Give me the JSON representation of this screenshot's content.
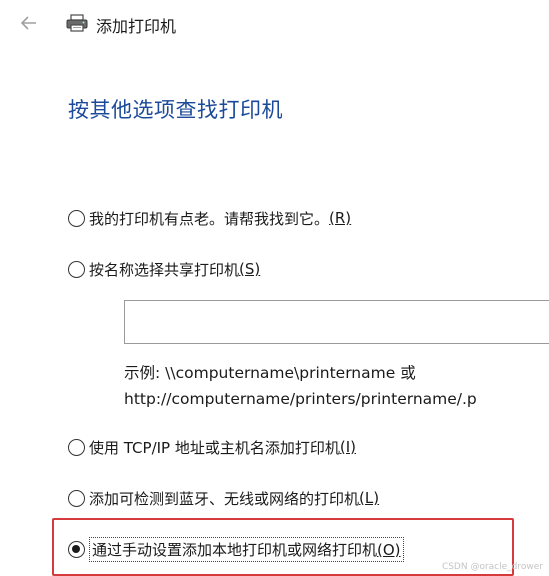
{
  "titlebar": {
    "back_icon": "back-arrow-icon",
    "title_icon": "printer-icon",
    "title": "添加打印机"
  },
  "heading": "按其他选项查找打印机",
  "options": [
    {
      "label": "我的打印机有点老。请帮我找到它。",
      "key": "(R)",
      "selected": false
    },
    {
      "label": "按名称选择共享打印机",
      "key": "(S)",
      "selected": false
    },
    {
      "label": "使用 TCP/IP 地址或主机名添加打印机",
      "key": "(I)",
      "selected": false
    },
    {
      "label": "添加可检测到蓝牙、无线或网络的打印机",
      "key": "(L)",
      "selected": false
    },
    {
      "label": "通过手动设置添加本地打印机或网络打印机",
      "key": "(O)",
      "selected": true
    }
  ],
  "shared_printer": {
    "value": "",
    "example_line1": "示例: \\\\computername\\printername 或",
    "example_line2": "http://computername/printers/printername/.p"
  },
  "highlight_color": "#d63b3b",
  "heading_color": "#1c4a9a",
  "watermark": "CSDN @oracle_drower"
}
